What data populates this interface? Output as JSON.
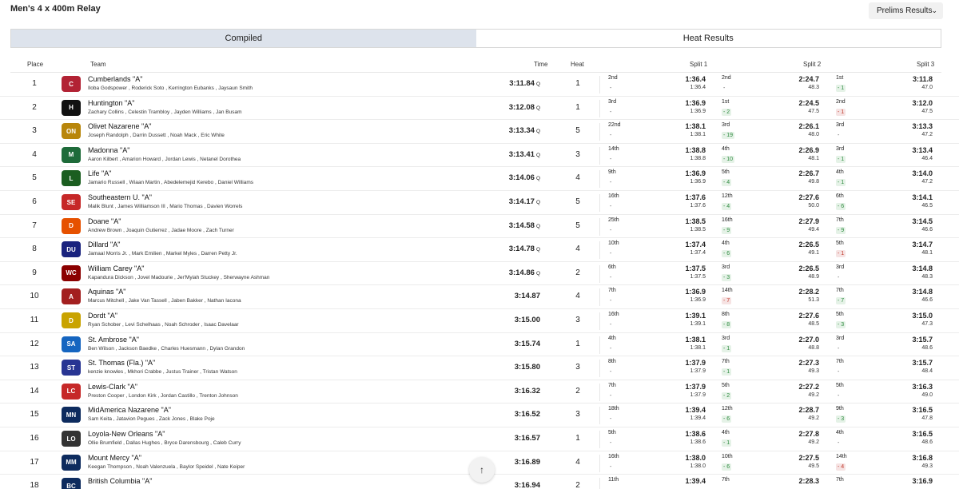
{
  "title": "Men's 4 x 400m Relay",
  "dropdown": {
    "label": "Prelims Results"
  },
  "tabs": [
    {
      "label": "Compiled"
    },
    {
      "label": "Heat Results"
    }
  ],
  "columns": {
    "place": "Place",
    "team": "Team",
    "time": "Time",
    "heat": "Heat",
    "split1": "Split 1",
    "split2": "Split 2",
    "split3": "Split 3"
  },
  "rows": [
    {
      "place": "1",
      "team": "Cumberlands \"A\"",
      "members": "Iloba Godspower ,  Roderick Soto ,  Kerrington Eubanks ,  Jaysaun Smith",
      "time": "3:11.84",
      "q": "Q",
      "heat": "1",
      "s1": {
        "rank": "2nd",
        "change": "-",
        "cum": "1:36.4",
        "lap": "1:36.4"
      },
      "s2": {
        "rank": "2nd",
        "change": "-",
        "cum": "2:24.7",
        "lap": "48.3"
      },
      "s3": {
        "rank": "1st",
        "change": "- 1",
        "cum": "3:11.8",
        "lap": "47.0"
      }
    },
    {
      "place": "2",
      "team": "Huntington \"A\"",
      "members": "Zachary Collins ,  Celestin Trambloy ,  Jayden Williams ,  Jan Busam",
      "time": "3:12.08",
      "q": "Q",
      "heat": "1",
      "s1": {
        "rank": "3rd",
        "change": "-",
        "cum": "1:36.9",
        "lap": "1:36.9"
      },
      "s2": {
        "rank": "1st",
        "change": "- 2",
        "cum": "2:24.5",
        "lap": "47.5"
      },
      "s3": {
        "rank": "2nd",
        "change": "- 1",
        "cum": "3:12.0",
        "lap": "47.5"
      }
    },
    {
      "place": "3",
      "team": "Olivet Nazarene \"A\"",
      "members": "Joseph Randolph ,  Darrin Dussett ,  Noah Mack ,  Eric White",
      "time": "3:13.34",
      "q": "Q",
      "heat": "5",
      "s1": {
        "rank": "22nd",
        "change": "-",
        "cum": "1:38.1",
        "lap": "1:38.1"
      },
      "s2": {
        "rank": "3rd",
        "change": "- 19",
        "cum": "2:26.1",
        "lap": "48.0"
      },
      "s3": {
        "rank": "3rd",
        "change": "-",
        "cum": "3:13.3",
        "lap": "47.2"
      }
    },
    {
      "place": "4",
      "team": "Madonna \"A\"",
      "members": "Aaron Kilbert ,  Amarion Howard ,  Jordan Lewis ,  Netanel Dorothea",
      "time": "3:13.41",
      "q": "Q",
      "heat": "3",
      "s1": {
        "rank": "14th",
        "change": "-",
        "cum": "1:38.8",
        "lap": "1:38.8"
      },
      "s2": {
        "rank": "4th",
        "change": "- 10",
        "cum": "2:26.9",
        "lap": "48.1"
      },
      "s3": {
        "rank": "3rd",
        "change": "- 1",
        "cum": "3:13.4",
        "lap": "46.4"
      }
    },
    {
      "place": "5",
      "team": "Life \"A\"",
      "members": "Jamario Russell ,  Wiaan Martin ,  Abedelemejid Kerebo ,  Daniel Williams",
      "time": "3:14.06",
      "q": "Q",
      "heat": "4",
      "s1": {
        "rank": "9th",
        "change": "-",
        "cum": "1:36.9",
        "lap": "1:36.9"
      },
      "s2": {
        "rank": "5th",
        "change": "- 4",
        "cum": "2:26.7",
        "lap": "49.8"
      },
      "s3": {
        "rank": "4th",
        "change": "- 1",
        "cum": "3:14.0",
        "lap": "47.2"
      }
    },
    {
      "place": "6",
      "team": "Southeastern U. \"A\"",
      "members": "Malik Blunt ,  James Williamson III ,  Mario Thomas ,  Davien Worrels",
      "time": "3:14.17",
      "q": "Q",
      "heat": "5",
      "s1": {
        "rank": "16th",
        "change": "-",
        "cum": "1:37.6",
        "lap": "1:37.6"
      },
      "s2": {
        "rank": "12th",
        "change": "- 4",
        "cum": "2:27.6",
        "lap": "50.0"
      },
      "s3": {
        "rank": "6th",
        "change": "- 6",
        "cum": "3:14.1",
        "lap": "46.5"
      }
    },
    {
      "place": "7",
      "team": "Doane \"A\"",
      "members": "Andrew Brown ,  Joaquin Gutierrez ,  Jadae Moore ,  Zach Turner",
      "time": "3:14.58",
      "q": "Q",
      "heat": "5",
      "s1": {
        "rank": "25th",
        "change": "-",
        "cum": "1:38.5",
        "lap": "1:38.5"
      },
      "s2": {
        "rank": "16th",
        "change": "- 9",
        "cum": "2:27.9",
        "lap": "49.4"
      },
      "s3": {
        "rank": "7th",
        "change": "- 9",
        "cum": "3:14.5",
        "lap": "46.6"
      }
    },
    {
      "place": "8",
      "team": "Dillard \"A\"",
      "members": "Jamaal Morris Jr. ,  Mark Emilien ,  Markel Myles ,  Darren Petty Jr.",
      "time": "3:14.78",
      "q": "Q",
      "heat": "4",
      "s1": {
        "rank": "10th",
        "change": "-",
        "cum": "1:37.4",
        "lap": "1:37.4"
      },
      "s2": {
        "rank": "4th",
        "change": "- 6",
        "cum": "2:26.5",
        "lap": "49.1"
      },
      "s3": {
        "rank": "5th",
        "change": "- 1",
        "cum": "3:14.7",
        "lap": "48.1"
      }
    },
    {
      "place": "9",
      "team": "William Carey \"A\"",
      "members": "Kapandura Dickson ,  Jovel Madourie ,  Jer'Myiah Stuckey ,  Sherwayne Ashman",
      "time": "3:14.86",
      "q": "Q",
      "heat": "2",
      "s1": {
        "rank": "6th",
        "change": "-",
        "cum": "1:37.5",
        "lap": "1:37.5"
      },
      "s2": {
        "rank": "3rd",
        "change": "- 3",
        "cum": "2:26.5",
        "lap": "48.9"
      },
      "s3": {
        "rank": "3rd",
        "change": "-",
        "cum": "3:14.8",
        "lap": "48.3"
      }
    },
    {
      "place": "10",
      "team": "Aquinas \"A\"",
      "members": "Marcus Mitchell ,  Jake Van Tassell ,  Jaben Bakker ,  Nathan Iacona",
      "time": "3:14.87",
      "q": "",
      "heat": "4",
      "s1": {
        "rank": "7th",
        "change": "-",
        "cum": "1:36.9",
        "lap": "1:36.9"
      },
      "s2": {
        "rank": "14th",
        "change": "- 7",
        "cum": "2:28.2",
        "lap": "51.3"
      },
      "s3": {
        "rank": "7th",
        "change": "- 7",
        "cum": "3:14.8",
        "lap": "46.6"
      }
    },
    {
      "place": "11",
      "team": "Dordt \"A\"",
      "members": "Ryan Schober ,  Levi Schelhaas ,  Noah Schroder ,  Isaac Davelaar",
      "time": "3:15.00",
      "q": "",
      "heat": "3",
      "s1": {
        "rank": "16th",
        "change": "-",
        "cum": "1:39.1",
        "lap": "1:39.1"
      },
      "s2": {
        "rank": "8th",
        "change": "- 8",
        "cum": "2:27.6",
        "lap": "48.5"
      },
      "s3": {
        "rank": "5th",
        "change": "- 3",
        "cum": "3:15.0",
        "lap": "47.3"
      }
    },
    {
      "place": "12",
      "team": "St. Ambrose \"A\"",
      "members": "Ben Wilson ,  Jackson Baedke ,  Charles Huesmann ,  Dylan Grandon",
      "time": "3:15.74",
      "q": "",
      "heat": "1",
      "s1": {
        "rank": "4th",
        "change": "-",
        "cum": "1:38.1",
        "lap": "1:38.1"
      },
      "s2": {
        "rank": "3rd",
        "change": "- 1",
        "cum": "2:27.0",
        "lap": "48.8"
      },
      "s3": {
        "rank": "3rd",
        "change": "-",
        "cum": "3:15.7",
        "lap": "48.6"
      }
    },
    {
      "place": "13",
      "team": "St. Thomas (Fla.) \"A\"",
      "members": "kenzie knowles ,  Mkhori Crabbe ,  Justus Trainer ,  Tristan Watson",
      "time": "3:15.80",
      "q": "",
      "heat": "3",
      "s1": {
        "rank": "8th",
        "change": "-",
        "cum": "1:37.9",
        "lap": "1:37.9"
      },
      "s2": {
        "rank": "7th",
        "change": "- 1",
        "cum": "2:27.3",
        "lap": "49.3"
      },
      "s3": {
        "rank": "7th",
        "change": "-",
        "cum": "3:15.7",
        "lap": "48.4"
      }
    },
    {
      "place": "14",
      "team": "Lewis-Clark \"A\"",
      "members": "Preston Cooper ,  London Kirk ,  Jordan Castillo ,  Trenton Johnson",
      "time": "3:16.32",
      "q": "",
      "heat": "2",
      "s1": {
        "rank": "7th",
        "change": "-",
        "cum": "1:37.9",
        "lap": "1:37.9"
      },
      "s2": {
        "rank": "5th",
        "change": "- 2",
        "cum": "2:27.2",
        "lap": "49.2"
      },
      "s3": {
        "rank": "5th",
        "change": "-",
        "cum": "3:16.3",
        "lap": "49.0"
      }
    },
    {
      "place": "15",
      "team": "MidAmerica Nazarene \"A\"",
      "members": "Sam Keita ,  Jatavion Pegues ,  Zack Jones ,  Blake Poje",
      "time": "3:16.52",
      "q": "",
      "heat": "3",
      "s1": {
        "rank": "18th",
        "change": "-",
        "cum": "1:39.4",
        "lap": "1:39.4"
      },
      "s2": {
        "rank": "12th",
        "change": "- 6",
        "cum": "2:28.7",
        "lap": "49.2"
      },
      "s3": {
        "rank": "9th",
        "change": "- 3",
        "cum": "3:16.5",
        "lap": "47.8"
      }
    },
    {
      "place": "16",
      "team": "Loyola-New Orleans \"A\"",
      "members": "Ollie Brumfield ,  Dallas Hughes ,  Bryce Darensbourg ,  Caleb Curry",
      "time": "3:16.57",
      "q": "",
      "heat": "1",
      "s1": {
        "rank": "5th",
        "change": "-",
        "cum": "1:38.6",
        "lap": "1:38.6"
      },
      "s2": {
        "rank": "4th",
        "change": "- 1",
        "cum": "2:27.8",
        "lap": "49.2"
      },
      "s3": {
        "rank": "4th",
        "change": "-",
        "cum": "3:16.5",
        "lap": "48.6"
      }
    },
    {
      "place": "17",
      "team": "Mount Mercy \"A\"",
      "members": "Keegan Thompson ,  Noah Valenzuela ,  Baylor Speidel ,  Nate Keiper",
      "time": "3:16.89",
      "q": "",
      "heat": "4",
      "s1": {
        "rank": "16th",
        "change": "-",
        "cum": "1:38.0",
        "lap": "1:38.0"
      },
      "s2": {
        "rank": "10th",
        "change": "- 6",
        "cum": "2:27.5",
        "lap": "49.5"
      },
      "s3": {
        "rank": "14th",
        "change": "- 4",
        "cum": "3:16.8",
        "lap": "49.3"
      }
    },
    {
      "place": "18",
      "team": "British Columbia \"A\"",
      "members": "",
      "time": "3:16.94",
      "q": "",
      "heat": "2",
      "s1": {
        "rank": "11th",
        "change": "",
        "cum": "1:39.4",
        "lap": ""
      },
      "s2": {
        "rank": "7th",
        "change": "",
        "cum": "2:28.3",
        "lap": ""
      },
      "s3": {
        "rank": "7th",
        "change": "",
        "cum": "3:16.9",
        "lap": ""
      }
    }
  ],
  "change_directions": {
    "2": [
      "up",
      "dn"
    ],
    "1": [
      "up",
      "up"
    ],
    "3": [
      "up",
      "eq"
    ],
    "4": [
      "up",
      "up"
    ],
    "5": [
      "up",
      "up"
    ],
    "6": [
      "up",
      "up"
    ],
    "7": [
      "up",
      "up"
    ],
    "8": [
      "up",
      "dn"
    ],
    "9": [
      "up",
      "eq"
    ],
    "10": [
      "dn",
      "up"
    ],
    "11": [
      "up",
      "up"
    ],
    "12": [
      "up",
      "eq"
    ],
    "13": [
      "up",
      "eq"
    ],
    "14": [
      "up",
      "eq"
    ],
    "15": [
      "up",
      "up"
    ],
    "16": [
      "up",
      "eq"
    ],
    "17": [
      "up",
      "dn"
    ],
    "18": [
      "eq",
      "eq"
    ]
  },
  "colors": {
    "up": "#2d8a3e",
    "down": "#c0392b",
    "tab_active": "#dde3ec"
  },
  "logos": [
    {
      "color": "#b22234",
      "text": "C"
    },
    {
      "color": "#111",
      "text": "H"
    },
    {
      "color": "#b8860b",
      "text": "ON"
    },
    {
      "color": "#1e6b3a",
      "text": "M"
    },
    {
      "color": "#1b5e20",
      "text": "L"
    },
    {
      "color": "#c62828",
      "text": "SE"
    },
    {
      "color": "#e65100",
      "text": "D"
    },
    {
      "color": "#1a237e",
      "text": "DU"
    },
    {
      "color": "#8b0000",
      "text": "WC"
    },
    {
      "color": "#a31f1f",
      "text": "A"
    },
    {
      "color": "#c9a300",
      "text": "D"
    },
    {
      "color": "#1565c0",
      "text": "SA"
    },
    {
      "color": "#283593",
      "text": "ST"
    },
    {
      "color": "#c62828",
      "text": "LC"
    },
    {
      "color": "#0d2b5e",
      "text": "MN"
    },
    {
      "color": "#333",
      "text": "LO"
    },
    {
      "color": "#0d2b5e",
      "text": "MM"
    },
    {
      "color": "#0d2b5e",
      "text": "BC"
    }
  ],
  "icons": {
    "scroll_top": "arrow-up-icon",
    "dropdown": "chevron-down-icon"
  }
}
